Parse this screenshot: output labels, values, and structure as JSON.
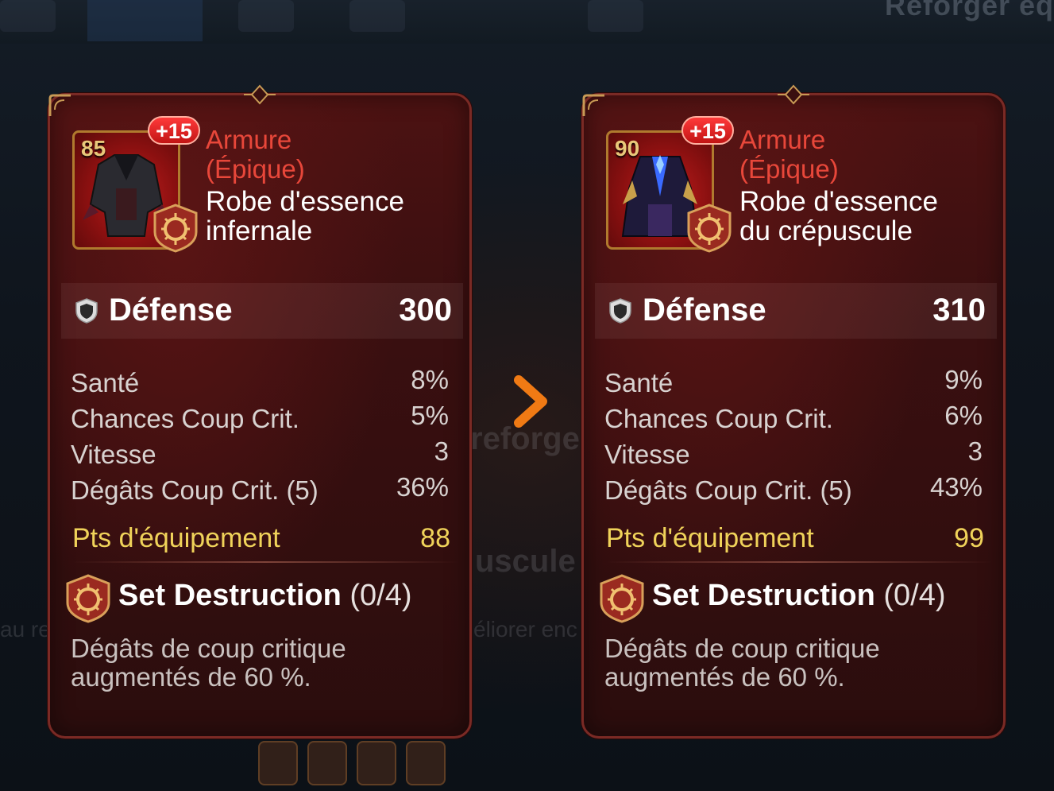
{
  "header": {
    "reforge_title": "Reforger éq"
  },
  "background_text": {
    "reforger": "reforger",
    "crepuscule": "uscule",
    "ameliorer": "éliorer enc",
    "left_fragment": "au re"
  },
  "before": {
    "level": "85",
    "enhance": "+15",
    "type_line1": "Armure",
    "type_line2": "(Épique)",
    "name_line1": "Robe d'essence",
    "name_line2": "infernale",
    "main_stat": {
      "label": "Défense",
      "value": "300"
    },
    "substats": [
      {
        "label": "Santé",
        "value": "8%"
      },
      {
        "label": "Chances Coup Crit.",
        "value": "5%"
      },
      {
        "label": "Vitesse",
        "value": "3"
      },
      {
        "label": "Dégâts Coup Crit. (5)",
        "value": "36%"
      }
    ],
    "gear_points": {
      "label": "Pts d'équipement",
      "value": "88"
    },
    "set": {
      "name": "Set Destruction",
      "progress": "(0/4)"
    },
    "set_desc_line1": "Dégâts de coup critique",
    "set_desc_line2": "augmentés de 60 %."
  },
  "after": {
    "level": "90",
    "enhance": "+15",
    "type_line1": "Armure",
    "type_line2": "(Épique)",
    "name_line1": "Robe d'essence",
    "name_line2": "du crépuscule",
    "main_stat": {
      "label": "Défense",
      "value": "310"
    },
    "substats": [
      {
        "label": "Santé",
        "value": "9%"
      },
      {
        "label": "Chances Coup Crit.",
        "value": "6%"
      },
      {
        "label": "Vitesse",
        "value": "3"
      },
      {
        "label": "Dégâts Coup Crit. (5)",
        "value": "43%"
      }
    ],
    "gear_points": {
      "label": "Pts d'équipement",
      "value": "99"
    },
    "set": {
      "name": "Set Destruction",
      "progress": "(0/4)"
    },
    "set_desc_line1": "Dégâts de coup critique",
    "set_desc_line2": "augmentés de 60 %."
  },
  "icons": {
    "arrow": "chevron-right-icon",
    "shield": "shield-icon",
    "set": "destruction-set-icon"
  },
  "colors": {
    "rarity_epic": "#e8473a",
    "gear_points": "#f0d35a",
    "arrow": "#f07a14",
    "card_bg": "#3a0f10"
  }
}
